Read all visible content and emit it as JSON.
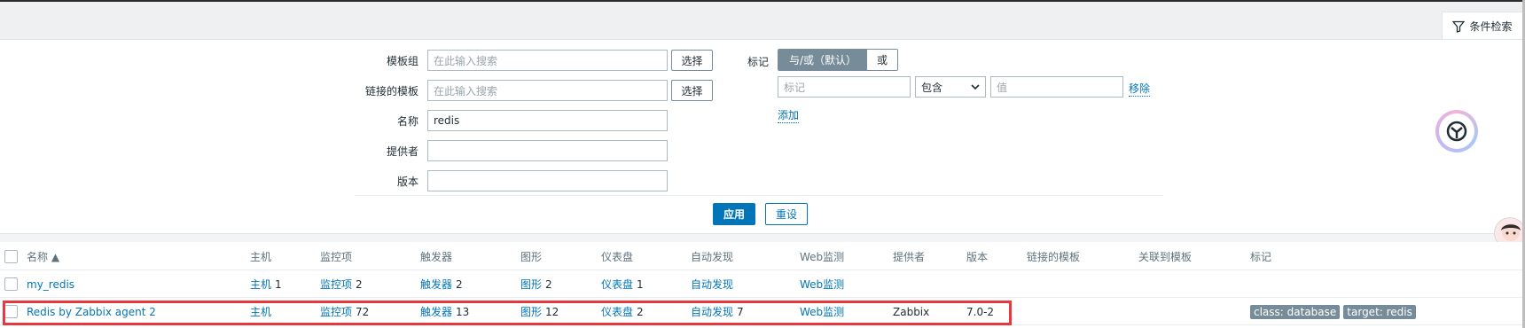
{
  "filter_tab": {
    "label": "条件检索"
  },
  "filter": {
    "template_group": {
      "label": "模板组",
      "placeholder": "在此输入搜索",
      "select": "选择"
    },
    "linked_templates": {
      "label": "链接的模板",
      "placeholder": "在此输入搜索",
      "select": "选择"
    },
    "name": {
      "label": "名称",
      "value": "redis"
    },
    "vendor": {
      "label": "提供者",
      "value": ""
    },
    "version": {
      "label": "版本",
      "value": ""
    },
    "tags": {
      "label": "标记",
      "op_and_or": "与/或（默认）",
      "op_or": "或",
      "tag_placeholder": "标记",
      "operator": "包含",
      "value_placeholder": "值",
      "remove": "移除",
      "add": "添加"
    },
    "apply": "应用",
    "reset": "重设"
  },
  "table": {
    "headers": {
      "name": "名称 ▲",
      "hosts": "主机",
      "items": "监控项",
      "triggers": "触发器",
      "graphs": "图形",
      "dashboards": "仪表盘",
      "discovery": "自动发现",
      "web": "Web监测",
      "vendor": "提供者",
      "version": "版本",
      "linked": "链接的模板",
      "linked_to": "关联到模板",
      "tags": "标记"
    },
    "rows": [
      {
        "name": "my_redis",
        "hosts": "主机",
        "hosts_count": "1",
        "items": "监控项",
        "items_count": "2",
        "triggers": "触发器",
        "triggers_count": "2",
        "graphs": "图形",
        "graphs_count": "2",
        "dashboards": "仪表盘",
        "dashboards_count": "1",
        "discovery": "自动发现",
        "discovery_count": "",
        "web": "Web监测",
        "vendor": "",
        "version": "",
        "tags": []
      },
      {
        "name": "Redis by Zabbix agent 2",
        "hosts": "主机",
        "hosts_count": "",
        "items": "监控项",
        "items_count": "72",
        "triggers": "触发器",
        "triggers_count": "13",
        "graphs": "图形",
        "graphs_count": "12",
        "dashboards": "仪表盘",
        "dashboards_count": "2",
        "discovery": "自动发现",
        "discovery_count": "7",
        "web": "Web监测",
        "vendor": "Zabbix",
        "version": "7.0-2",
        "tags": [
          "class: database",
          "target: redis"
        ]
      }
    ]
  },
  "colors": {
    "accent": "#0275b8",
    "highlight": "#e8383d",
    "tag_bg": "#768d99"
  }
}
